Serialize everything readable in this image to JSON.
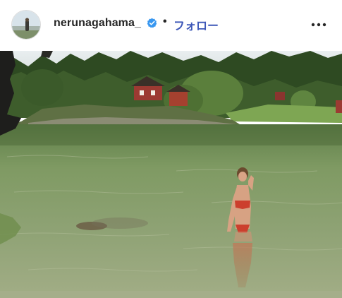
{
  "post_header": {
    "username": "nerunagahama_",
    "verified_icon": "verified-badge-icon",
    "separator": "•",
    "follow_label": "フォロー",
    "more_icon": "more-options-icon",
    "accent_color": "#3d57b8",
    "verified_color": "#3897f0"
  },
  "post_media": {
    "type": "photo",
    "dominant_colors": [
      "#6e8a56",
      "#8aa06a",
      "#2f4a24",
      "#9c3a32"
    ]
  }
}
